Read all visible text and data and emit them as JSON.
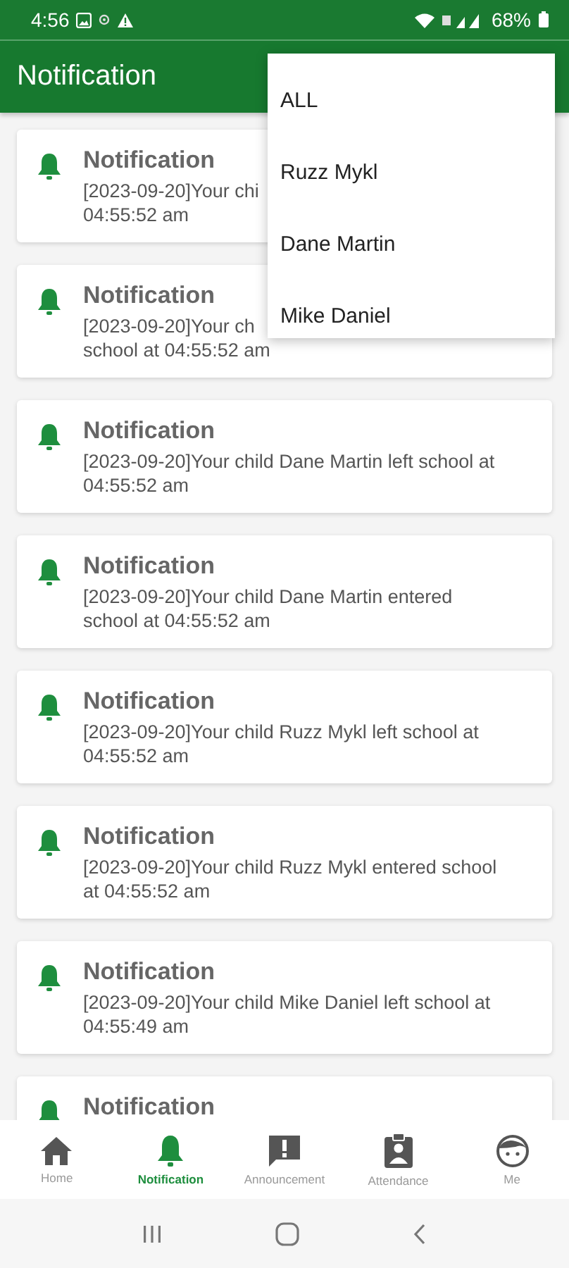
{
  "status_bar": {
    "time": "4:56",
    "battery": "68%"
  },
  "app_bar": {
    "title": "Notification"
  },
  "cards": [
    {
      "title": "Notification",
      "lines": [
        "[2023-09-20]Your chi",
        "04:55:52 am"
      ]
    },
    {
      "title": "Notification",
      "lines": [
        "[2023-09-20]Your ch",
        "school at 04:55:52 am"
      ]
    },
    {
      "title": "Notification",
      "lines": [
        "[2023-09-20]Your child Dane Martin left school at",
        "04:55:52 am"
      ]
    },
    {
      "title": "Notification",
      "lines": [
        "[2023-09-20]Your child Dane Martin entered",
        "school at 04:55:52 am"
      ]
    },
    {
      "title": "Notification",
      "lines": [
        "[2023-09-20]Your child Ruzz Mykl left school at",
        "04:55:52 am"
      ]
    },
    {
      "title": "Notification",
      "lines": [
        "[2023-09-20]Your child Ruzz Mykl entered school",
        "at 04:55:52 am"
      ]
    },
    {
      "title": "Notification",
      "lines": [
        "[2023-09-20]Your child Mike Daniel left school at",
        "04:55:49 am"
      ]
    },
    {
      "title": "Notification"
    }
  ],
  "menu": {
    "items": [
      "ALL",
      "Ruzz Mykl",
      "Dane Martin",
      "Mike Daniel"
    ]
  },
  "bottom_nav": [
    {
      "kind": "home",
      "label": "Home",
      "selected": false
    },
    {
      "kind": "bell",
      "label": "Notification",
      "selected": true
    },
    {
      "kind": "alert",
      "label": "Announcement",
      "selected": false
    },
    {
      "kind": "badge",
      "label": "Attendance",
      "selected": false
    },
    {
      "kind": "face",
      "label": "Me",
      "selected": false
    }
  ]
}
